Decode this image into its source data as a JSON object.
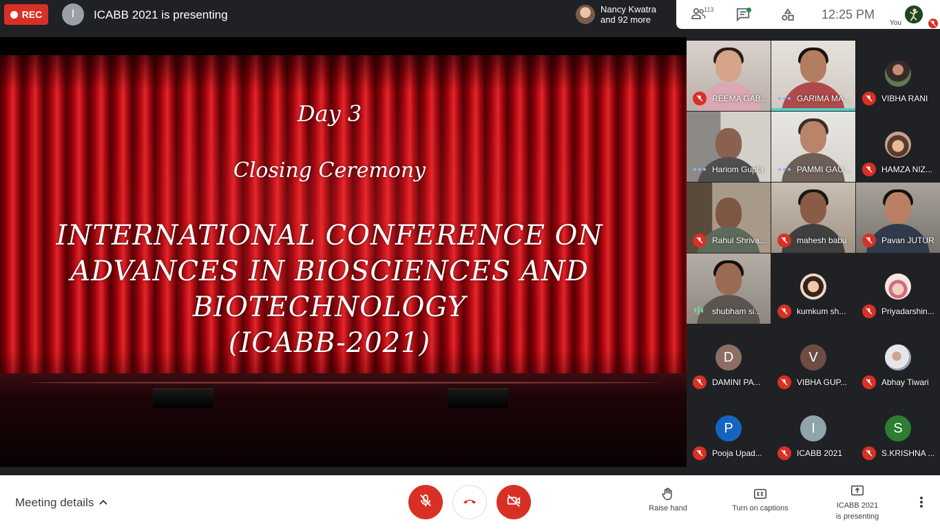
{
  "top_bar": {
    "rec_label": "REC",
    "presenter_initial": "I",
    "presenting_text": "ICABB 2021 is presenting",
    "joiners_line1": "Nancy Kwatra",
    "joiners_line2": "and 92 more",
    "people_count": "113",
    "time": "12:25 PM",
    "self_label": "You"
  },
  "slide": {
    "line1": "Day 3",
    "line2": "Closing Ceremony",
    "title_lines": [
      "INTERNATIONAL CONFERENCE ON",
      "ADVANCES IN BIOSCIENCES AND",
      "BIOTECHNOLOGY",
      "(ICABB-2021)"
    ]
  },
  "participants": [
    {
      "name": "REEMA GAB...",
      "status": "muted"
    },
    {
      "name": "GARIMA MA...",
      "status": "speaking"
    },
    {
      "name": "VIBHA RANI",
      "status": "muted"
    },
    {
      "name": "Hariom Gupta",
      "status": "active"
    },
    {
      "name": "PAMMI GAU...",
      "status": "active"
    },
    {
      "name": "HAMZA NIZ...",
      "status": "muted"
    },
    {
      "name": "Rahul Shriva...",
      "status": "muted"
    },
    {
      "name": "mahesh babu",
      "status": "muted"
    },
    {
      "name": "Pavan JUTUR",
      "status": "muted"
    },
    {
      "name": "shubham si...",
      "status": "talking"
    },
    {
      "name": "kumkum sh...",
      "status": "muted"
    },
    {
      "name": "Priyadarshin...",
      "status": "muted"
    },
    {
      "name": "DAMINI PA...",
      "status": "muted",
      "initial": "D",
      "color": "#8d6e63"
    },
    {
      "name": "VIBHA GUP...",
      "status": "muted",
      "initial": "V",
      "color": "#6d4c41"
    },
    {
      "name": "Abhay Tiwari",
      "status": "muted"
    },
    {
      "name": "Pooja Upad...",
      "status": "muted",
      "initial": "P",
      "color": "#1565c0"
    },
    {
      "name": "ICABB 2021",
      "status": "muted",
      "initial": "I",
      "color": "#90a4ae"
    },
    {
      "name": "S.KRISHNA ...",
      "status": "muted",
      "initial": "S",
      "color": "#2e7d32"
    }
  ],
  "bottom_bar": {
    "meeting_details": "Meeting details",
    "raise_hand": "Raise hand",
    "captions": "Turn on captions",
    "presenting_line1": "ICABB 2021",
    "presenting_line2": "is presenting"
  },
  "icons": [
    "record-dot",
    "people-icon",
    "chat-icon",
    "activities-icon",
    "mic-off-icon",
    "hang-up-icon",
    "camera-off-icon",
    "hand-icon",
    "captions-icon",
    "present-icon",
    "more-vert-icon"
  ],
  "colors": {
    "accent_red": "#d93025",
    "bar_dark": "#202124",
    "tile": "#3c4043",
    "speaking": "#4fd1c5"
  }
}
